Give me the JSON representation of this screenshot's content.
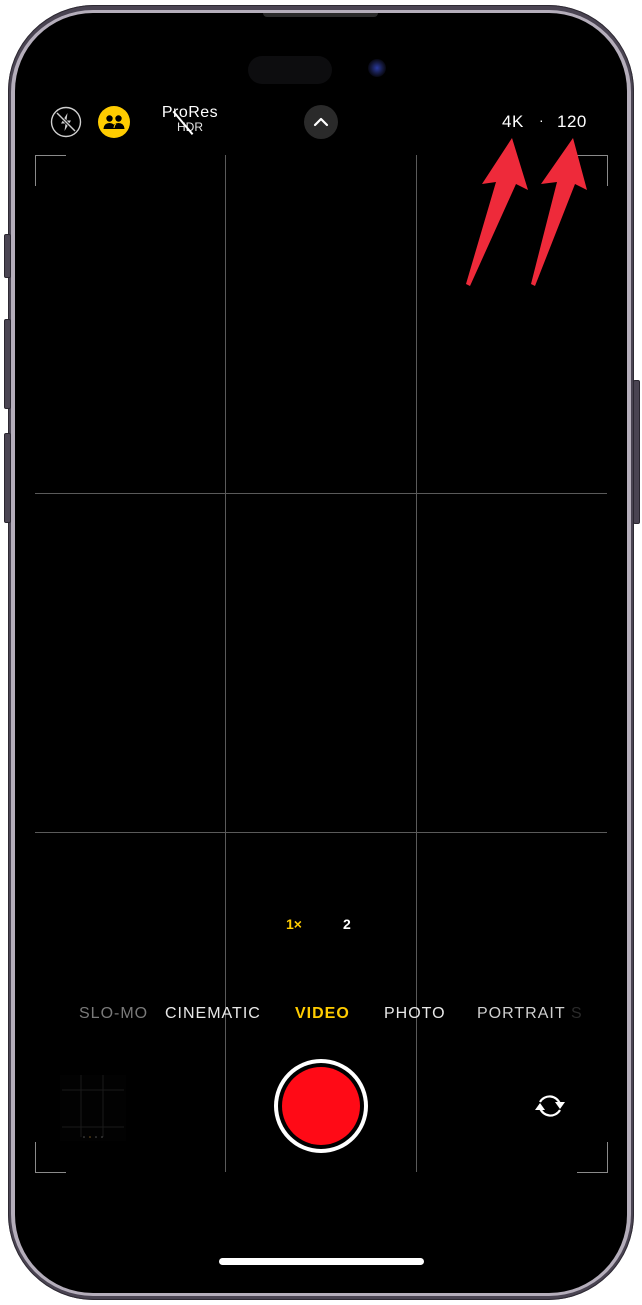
{
  "top_bar": {
    "flash_icon": "flash-off-icon",
    "shared_library_icon": "shared-library-icon",
    "prores_label": "ProRes",
    "hdr_label": "HDR",
    "expand_icon": "chevron-up-icon",
    "resolution_label": "4K",
    "separator": "·",
    "frame_rate_label": "120"
  },
  "zoom": {
    "options": [
      {
        "label": "1×",
        "active": true
      },
      {
        "label": "2",
        "active": false
      }
    ]
  },
  "modes": {
    "items": [
      {
        "label": "SLO-MO",
        "active": false
      },
      {
        "label": "CINEMATIC",
        "active": false
      },
      {
        "label": "VIDEO",
        "active": true
      },
      {
        "label": "PHOTO",
        "active": false
      },
      {
        "label": "PORTRAIT",
        "active": false
      },
      {
        "label": "S",
        "active": false
      }
    ]
  },
  "bottom_bar": {
    "shutter": "record-button",
    "flip_icon": "camera-flip-icon"
  },
  "colors": {
    "accent_yellow": "#ffcc00",
    "record_red": "#ff0a16",
    "annotation_arrow": "#ee2a3a"
  }
}
